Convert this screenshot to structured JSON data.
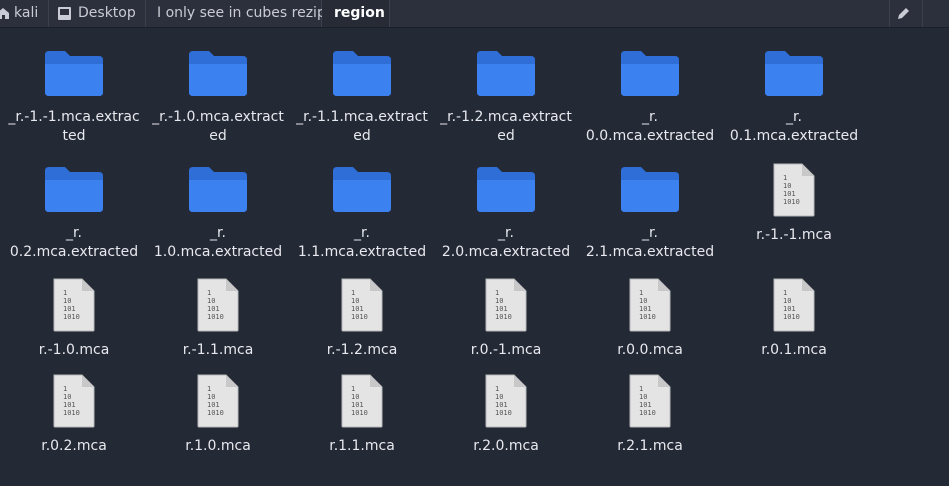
{
  "pathbar": {
    "crumbs": [
      "kali",
      "Desktop",
      "I only see in cubes rezip",
      "region"
    ]
  },
  "icon_names": {
    "folder": "folder-icon",
    "file": "binary-file-icon",
    "edit": "pencil-icon",
    "home": "home-icon",
    "desktop": "desktop-icon"
  },
  "folders": [
    {
      "l1": "_r.-1.-1.mca.extrac",
      "l2": "ted"
    },
    {
      "l1": "_r.-1.0.mca.extract",
      "l2": "ed"
    },
    {
      "l1": "_r.-1.1.mca.extract",
      "l2": "ed"
    },
    {
      "l1": "_r.-1.2.mca.extract",
      "l2": "ed"
    },
    {
      "l1": "_r.",
      "l2": "0.0.mca.extracted"
    },
    {
      "l1": "_r.",
      "l2": "0.1.mca.extracted"
    },
    {
      "l1": "_r.",
      "l2": "0.2.mca.extracted"
    },
    {
      "l1": "_r.",
      "l2": "1.0.mca.extracted"
    },
    {
      "l1": "_r.",
      "l2": "1.1.mca.extracted"
    },
    {
      "l1": "_r.",
      "l2": "2.0.mca.extracted"
    },
    {
      "l1": "_r.",
      "l2": "2.1.mca.extracted"
    }
  ],
  "files": [
    "r.-1.-1.mca",
    "r.-1.0.mca",
    "r.-1.1.mca",
    "r.-1.2.mca",
    "r.0.-1.mca",
    "r.0.0.mca",
    "r.0.1.mca",
    "r.0.2.mca",
    "r.1.0.mca",
    "r.1.1.mca",
    "r.2.0.mca",
    "r.2.1.mca"
  ],
  "file_icon_text": [
    "1",
    "10",
    "101",
    "1010"
  ]
}
